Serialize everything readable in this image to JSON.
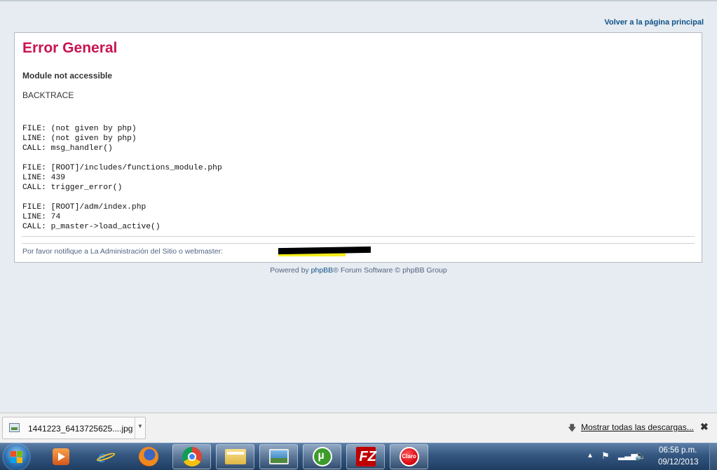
{
  "page": {
    "return_link": "Volver a la página principal",
    "error_title": "Error General",
    "error_message": "Module not accessible",
    "backtrace_label": "BACKTRACE",
    "trace": [
      [
        "FILE: (not given by php)",
        "LINE: (not given by php)",
        "CALL: msg_handler()"
      ],
      [
        "FILE: [ROOT]/includes/functions_module.php",
        "LINE: 439",
        "CALL: trigger_error()"
      ],
      [
        "FILE: [ROOT]/adm/index.php",
        "LINE: 74",
        "CALL: p_master->load_active()"
      ]
    ],
    "notify_text": "Por favor notifique a La Administración del Sitio o webmaster:",
    "powered_prefix": "Powered by ",
    "powered_brand": "phpBB",
    "powered_suffix": "® Forum Software © phpBB Group"
  },
  "downloads": {
    "file_name": "1441223_6413725625....jpg",
    "show_all": "Mostrar todas las descargas...",
    "close": "✖"
  },
  "taskbar": {
    "apps": [
      "windows-media-player",
      "internet-explorer",
      "firefox",
      "chrome",
      "windows-explorer",
      "photo-viewer",
      "utorrent",
      "filezilla",
      "claro"
    ],
    "active_apps": [
      "chrome",
      "windows-explorer",
      "photo-viewer",
      "utorrent",
      "filezilla",
      "claro"
    ],
    "clock_time": "06:56 p.m.",
    "clock_date": "09/12/2013"
  },
  "colors": {
    "error_title": "#c8144e",
    "link": "#105289",
    "page_bg": "#e6ecf1"
  }
}
